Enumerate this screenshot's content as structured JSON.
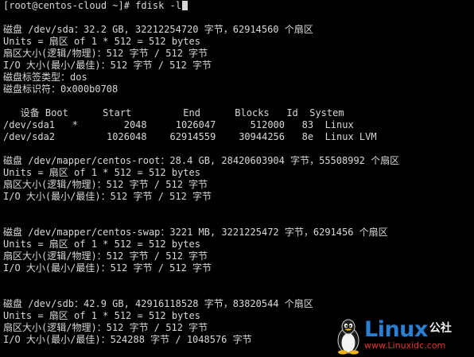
{
  "terminal": {
    "lines": [
      "[root@centos-cloud ~]# fdisk -l",
      "",
      "磁盘 /dev/sda：32.2 GB, 32212254720 字节，62914560 个扇区",
      "Units = 扇区 of 1 * 512 = 512 bytes",
      "扇区大小(逻辑/物理)：512 字节 / 512 字节",
      "I/O 大小(最小/最佳)：512 字节 / 512 字节",
      "磁盘标签类型：dos",
      "磁盘标识符：0x000b0708",
      "",
      "   设备 Boot      Start         End      Blocks   Id  System",
      "/dev/sda1   *        2048     1026047      512000   83  Linux",
      "/dev/sda2         1026048    62914559    30944256   8e  Linux LVM",
      "",
      "磁盘 /dev/mapper/centos-root：28.4 GB, 28420603904 字节，55508992 个扇区",
      "Units = 扇区 of 1 * 512 = 512 bytes",
      "扇区大小(逻辑/物理)：512 字节 / 512 字节",
      "I/O 大小(最小/最佳)：512 字节 / 512 字节",
      "",
      "",
      "磁盘 /dev/mapper/centos-swap：3221 MB, 3221225472 字节，6291456 个扇区",
      "Units = 扇区 of 1 * 512 = 512 bytes",
      "扇区大小(逻辑/物理)：512 字节 / 512 字节",
      "I/O 大小(最小/最佳)：512 字节 / 512 字节",
      "",
      "",
      "磁盘 /dev/sdb：42.9 GB, 42916118528 字节，83820544 个扇区",
      "Units = 扇区 of 1 * 512 = 512 bytes",
      "扇区大小(逻辑/物理)：512 字节 / 512 字节",
      "I/O 大小(最小/最佳)：524288 字节 / 1048576 字节"
    ],
    "text_color": "#d8d8d8",
    "background_color": "#000000"
  },
  "watermark": {
    "brand": "Linux",
    "brand_suffix": "公社",
    "url": "www.Linuxidc.com",
    "icon": "tux-penguin-icon",
    "brand_color": "#2a7fd0",
    "url_color": "#e0392f"
  }
}
